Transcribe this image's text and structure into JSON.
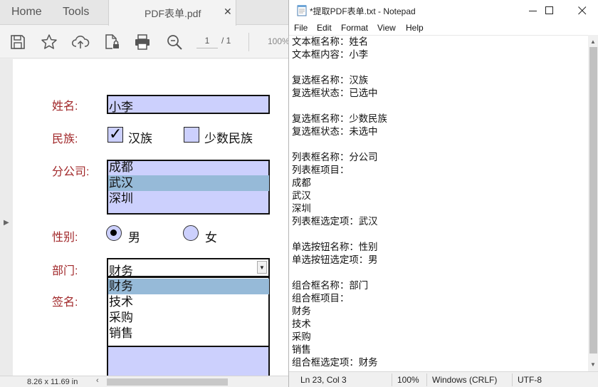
{
  "pdf_viewer": {
    "tabs": {
      "home": "Home",
      "tools": "Tools",
      "document": "PDF表单.pdf"
    },
    "toolbar": {
      "page_current": "1",
      "page_total": "/ 1",
      "zoom": "100%"
    },
    "form": {
      "name": {
        "label": "姓名:",
        "value": "小李"
      },
      "ethnicity": {
        "label": "民族:",
        "options": [
          {
            "label": "汉族",
            "checked": true
          },
          {
            "label": "少数民族",
            "checked": false
          }
        ]
      },
      "branch": {
        "label": "分公司:",
        "items": [
          "成都",
          "武汉",
          "深圳"
        ],
        "selected": "武汉"
      },
      "gender": {
        "label": "性别:",
        "options": [
          {
            "label": "男",
            "selected": true
          },
          {
            "label": "女",
            "selected": false
          }
        ]
      },
      "department": {
        "label": "部门:",
        "value": "财务",
        "options": [
          "财务",
          "技术",
          "采购",
          "销售"
        ],
        "highlighted": "财务"
      },
      "signature": {
        "label": "签名:"
      }
    },
    "status": {
      "page_size": "8.26 x 11.69 in"
    }
  },
  "notepad": {
    "title": "*提取PDF表单.txt - Notepad",
    "menu": [
      "File",
      "Edit",
      "Format",
      "View",
      "Help"
    ],
    "content": "文本框名称：姓名\n文本框内容：小李\n\n复选框名称：汉族\n复选框状态：已选中\n\n复选框名称：少数民族\n复选框状态：未选中\n\n列表框名称：分公司\n列表框项目：\n成都\n武汉\n深圳\n列表框选定项：武汉\n\n单选按钮名称：性别\n单选按钮选定项：男\n\n组合框名称：部门\n组合框项目：\n财务\n技术\n采购\n销售\n组合框选定项：财务",
    "status": {
      "position": "Ln 23, Col 3",
      "zoom": "100%",
      "line_ending": "Windows (CRLF)",
      "encoding": "UTF-8"
    }
  },
  "colors": {
    "field_fill": "#ccd0fd",
    "label": "#a1282a",
    "selection": "#96bad8"
  }
}
